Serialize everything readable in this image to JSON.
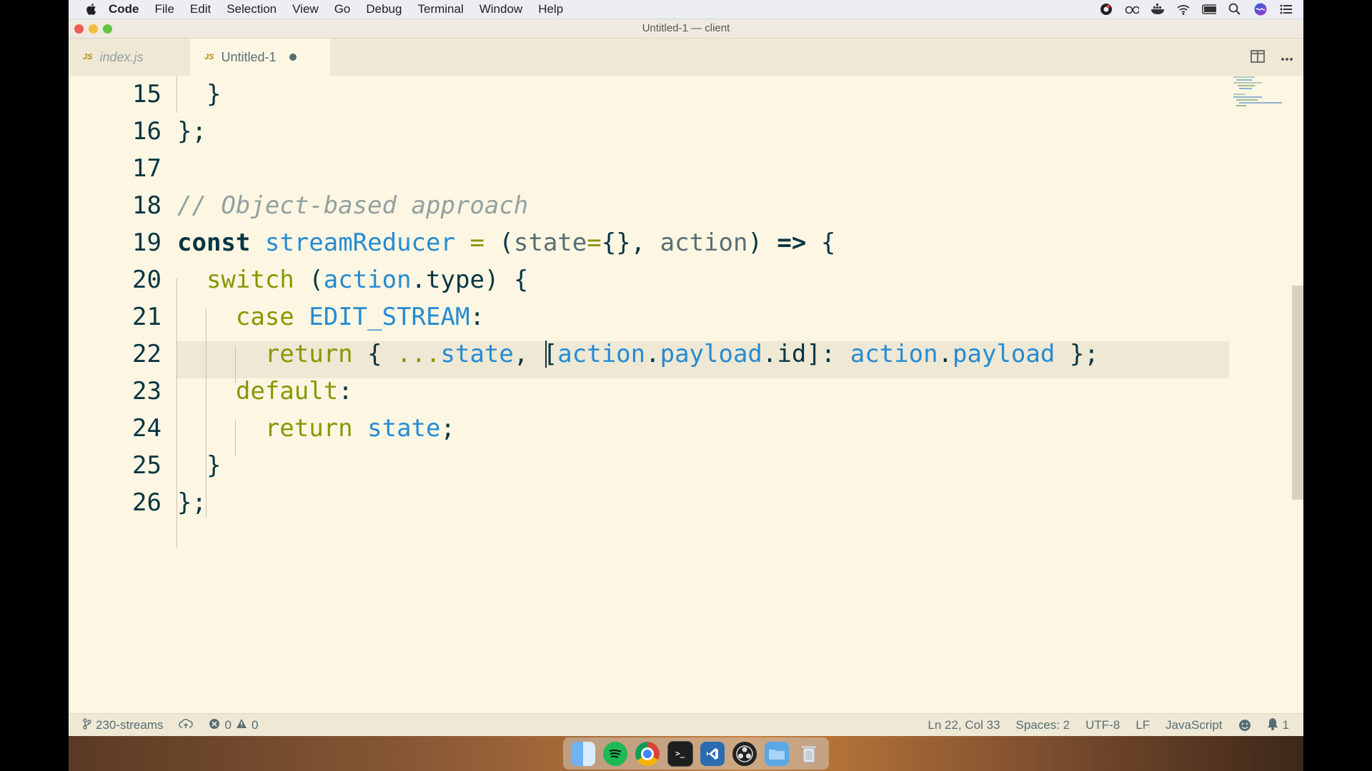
{
  "menubar": {
    "app": "Code",
    "items": [
      "File",
      "Edit",
      "Selection",
      "View",
      "Go",
      "Debug",
      "Terminal",
      "Window",
      "Help"
    ],
    "status_icons": [
      "creative-cloud-icon",
      "glasses-icon",
      "docker-icon",
      "wifi-icon",
      "battery-icon",
      "spotlight-icon",
      "siri-icon",
      "notification-center-icon"
    ]
  },
  "window": {
    "title": "Untitled-1 — client"
  },
  "tabs": [
    {
      "label": "index.js",
      "icon": "JS",
      "active": false
    },
    {
      "label": "Untitled-1",
      "icon": "JS",
      "active": true,
      "dirty": true
    }
  ],
  "editor": {
    "current_line": 22,
    "lines": [
      {
        "n": "15",
        "text": "  }"
      },
      {
        "n": "16",
        "text": "};"
      },
      {
        "n": "17",
        "text": ""
      },
      {
        "n": "18",
        "text": "// Object-based approach"
      },
      {
        "n": "19",
        "text": "const streamReducer = (state={}, action) => {"
      },
      {
        "n": "20",
        "text": "  switch (action.type) {"
      },
      {
        "n": "21",
        "text": "    case EDIT_STREAM:"
      },
      {
        "n": "22",
        "text": "      return { ...state, [action.payload.id]: action.payload };"
      },
      {
        "n": "23",
        "text": "    default:"
      },
      {
        "n": "24",
        "text": "      return state;"
      },
      {
        "n": "25",
        "text": "  }"
      },
      {
        "n": "26",
        "text": "};"
      }
    ]
  },
  "statusbar": {
    "branch": "230-streams",
    "errors": "0",
    "warnings": "0",
    "position": "Ln 22, Col 33",
    "spaces": "Spaces: 2",
    "encoding": "UTF-8",
    "eol": "LF",
    "language": "JavaScript",
    "notifications": "1"
  },
  "dock": {
    "apps": [
      "finder-icon",
      "spotify-icon",
      "chrome-icon",
      "terminal-icon",
      "vscode-icon",
      "obs-icon",
      "folder-icon",
      "trash-icon"
    ]
  },
  "colors": {
    "editor_bg": "#fdf6e3",
    "keyword": "#073642",
    "identifier": "#268bd2",
    "control": "#859900",
    "comment": "#93a1a1"
  }
}
